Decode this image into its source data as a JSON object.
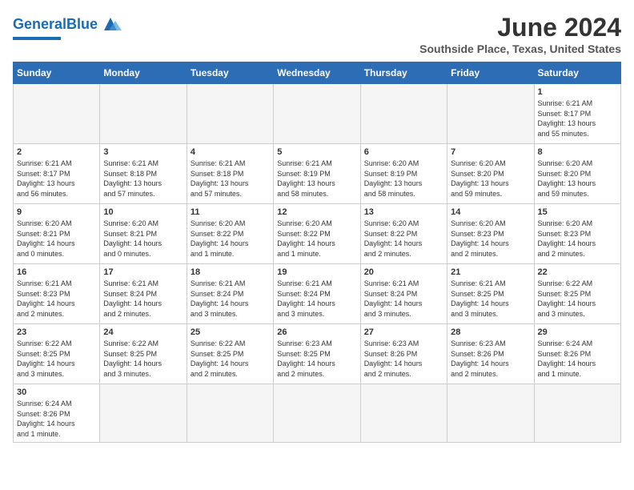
{
  "header": {
    "logo_general": "General",
    "logo_blue": "Blue",
    "month": "June 2024",
    "location": "Southside Place, Texas, United States"
  },
  "weekdays": [
    "Sunday",
    "Monday",
    "Tuesday",
    "Wednesday",
    "Thursday",
    "Friday",
    "Saturday"
  ],
  "weeks": [
    [
      {
        "day": "",
        "info": ""
      },
      {
        "day": "",
        "info": ""
      },
      {
        "day": "",
        "info": ""
      },
      {
        "day": "",
        "info": ""
      },
      {
        "day": "",
        "info": ""
      },
      {
        "day": "",
        "info": ""
      },
      {
        "day": "1",
        "info": "Sunrise: 6:21 AM\nSunset: 8:17 PM\nDaylight: 13 hours\nand 55 minutes."
      }
    ],
    [
      {
        "day": "2",
        "info": "Sunrise: 6:21 AM\nSunset: 8:17 PM\nDaylight: 13 hours\nand 56 minutes."
      },
      {
        "day": "3",
        "info": "Sunrise: 6:21 AM\nSunset: 8:18 PM\nDaylight: 13 hours\nand 57 minutes."
      },
      {
        "day": "4",
        "info": "Sunrise: 6:21 AM\nSunset: 8:18 PM\nDaylight: 13 hours\nand 57 minutes."
      },
      {
        "day": "5",
        "info": "Sunrise: 6:21 AM\nSunset: 8:19 PM\nDaylight: 13 hours\nand 58 minutes."
      },
      {
        "day": "6",
        "info": "Sunrise: 6:20 AM\nSunset: 8:19 PM\nDaylight: 13 hours\nand 58 minutes."
      },
      {
        "day": "7",
        "info": "Sunrise: 6:20 AM\nSunset: 8:20 PM\nDaylight: 13 hours\nand 59 minutes."
      },
      {
        "day": "8",
        "info": "Sunrise: 6:20 AM\nSunset: 8:20 PM\nDaylight: 13 hours\nand 59 minutes."
      }
    ],
    [
      {
        "day": "9",
        "info": "Sunrise: 6:20 AM\nSunset: 8:21 PM\nDaylight: 14 hours\nand 0 minutes."
      },
      {
        "day": "10",
        "info": "Sunrise: 6:20 AM\nSunset: 8:21 PM\nDaylight: 14 hours\nand 0 minutes."
      },
      {
        "day": "11",
        "info": "Sunrise: 6:20 AM\nSunset: 8:22 PM\nDaylight: 14 hours\nand 1 minute."
      },
      {
        "day": "12",
        "info": "Sunrise: 6:20 AM\nSunset: 8:22 PM\nDaylight: 14 hours\nand 1 minute."
      },
      {
        "day": "13",
        "info": "Sunrise: 6:20 AM\nSunset: 8:22 PM\nDaylight: 14 hours\nand 2 minutes."
      },
      {
        "day": "14",
        "info": "Sunrise: 6:20 AM\nSunset: 8:23 PM\nDaylight: 14 hours\nand 2 minutes."
      },
      {
        "day": "15",
        "info": "Sunrise: 6:20 AM\nSunset: 8:23 PM\nDaylight: 14 hours\nand 2 minutes."
      }
    ],
    [
      {
        "day": "16",
        "info": "Sunrise: 6:21 AM\nSunset: 8:23 PM\nDaylight: 14 hours\nand 2 minutes."
      },
      {
        "day": "17",
        "info": "Sunrise: 6:21 AM\nSunset: 8:24 PM\nDaylight: 14 hours\nand 2 minutes."
      },
      {
        "day": "18",
        "info": "Sunrise: 6:21 AM\nSunset: 8:24 PM\nDaylight: 14 hours\nand 3 minutes."
      },
      {
        "day": "19",
        "info": "Sunrise: 6:21 AM\nSunset: 8:24 PM\nDaylight: 14 hours\nand 3 minutes."
      },
      {
        "day": "20",
        "info": "Sunrise: 6:21 AM\nSunset: 8:24 PM\nDaylight: 14 hours\nand 3 minutes."
      },
      {
        "day": "21",
        "info": "Sunrise: 6:21 AM\nSunset: 8:25 PM\nDaylight: 14 hours\nand 3 minutes."
      },
      {
        "day": "22",
        "info": "Sunrise: 6:22 AM\nSunset: 8:25 PM\nDaylight: 14 hours\nand 3 minutes."
      }
    ],
    [
      {
        "day": "23",
        "info": "Sunrise: 6:22 AM\nSunset: 8:25 PM\nDaylight: 14 hours\nand 3 minutes."
      },
      {
        "day": "24",
        "info": "Sunrise: 6:22 AM\nSunset: 8:25 PM\nDaylight: 14 hours\nand 3 minutes."
      },
      {
        "day": "25",
        "info": "Sunrise: 6:22 AM\nSunset: 8:25 PM\nDaylight: 14 hours\nand 2 minutes."
      },
      {
        "day": "26",
        "info": "Sunrise: 6:23 AM\nSunset: 8:25 PM\nDaylight: 14 hours\nand 2 minutes."
      },
      {
        "day": "27",
        "info": "Sunrise: 6:23 AM\nSunset: 8:26 PM\nDaylight: 14 hours\nand 2 minutes."
      },
      {
        "day": "28",
        "info": "Sunrise: 6:23 AM\nSunset: 8:26 PM\nDaylight: 14 hours\nand 2 minutes."
      },
      {
        "day": "29",
        "info": "Sunrise: 6:24 AM\nSunset: 8:26 PM\nDaylight: 14 hours\nand 1 minute."
      }
    ],
    [
      {
        "day": "30",
        "info": "Sunrise: 6:24 AM\nSunset: 8:26 PM\nDaylight: 14 hours\nand 1 minute."
      },
      {
        "day": "",
        "info": ""
      },
      {
        "day": "",
        "info": ""
      },
      {
        "day": "",
        "info": ""
      },
      {
        "day": "",
        "info": ""
      },
      {
        "day": "",
        "info": ""
      },
      {
        "day": "",
        "info": ""
      }
    ]
  ]
}
